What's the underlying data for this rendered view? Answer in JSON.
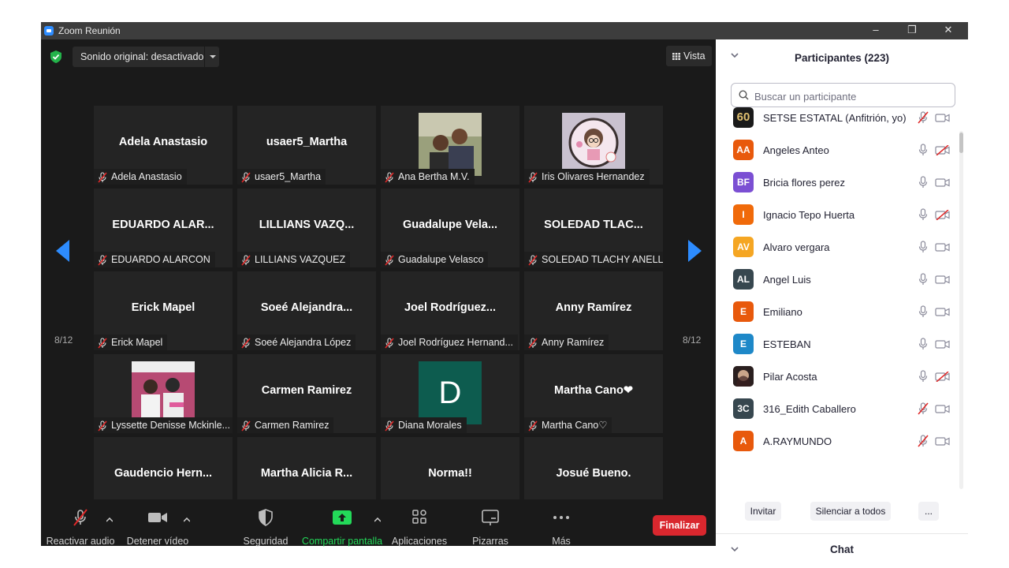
{
  "window": {
    "title": "Zoom Reunión",
    "minimize": "–",
    "restore": "❐",
    "close": "✕"
  },
  "meeting": {
    "audio_status": "Sonido original: desactivado",
    "view_label": "Vista",
    "page_left": "8/12",
    "page_right": "8/12",
    "tiles": [
      {
        "big": "Adela Anastasio",
        "name": "Adela Anastasio"
      },
      {
        "big": "usaer5_Martha",
        "name": "usaer5_Martha"
      },
      {
        "big": "",
        "name": "Ana Bertha M.V."
      },
      {
        "big": "",
        "name": "Iris Olivares Hernandez"
      },
      {
        "big": "EDUARDO ALAR...",
        "name": "EDUARDO ALARCON"
      },
      {
        "big": "LILLIANS VAZQ...",
        "name": "LILLIANS VAZQUEZ"
      },
      {
        "big": "Guadalupe  Vela...",
        "name": "Guadalupe Velasco"
      },
      {
        "big": "SOLEDAD  TLAC...",
        "name": "SOLEDAD TLACHY ANELL"
      },
      {
        "big": "Erick Mapel",
        "name": "Erick Mapel"
      },
      {
        "big": "Soeé  Alejandra...",
        "name": "Soeé Alejandra López"
      },
      {
        "big": "Joel  Rodríguez...",
        "name": "Joel Rodríguez Hernand..."
      },
      {
        "big": "Anny Ramírez",
        "name": "Anny Ramírez"
      },
      {
        "big": "",
        "name": "Lyssette Denisse Mckinle..."
      },
      {
        "big": "Carmen Ramirez",
        "name": "Carmen Ramirez"
      },
      {
        "big": "",
        "name": "Diana Morales",
        "initial": "D"
      },
      {
        "big": "Martha  Cano❤",
        "name": "Martha Cano♡"
      },
      {
        "big": "Gaudencio  Hern...",
        "name": "Gaudencio Hernández V..."
      },
      {
        "big": "Martha Alicia  R...",
        "name": "Martha Alicia Ramos Na..."
      },
      {
        "big": "Norma!!",
        "name": "Norma!!"
      },
      {
        "big": "Josué Bueno.",
        "name": "Josué Bueno."
      }
    ]
  },
  "toolbar": {
    "unmute": "Reactivar audio",
    "stop_video": "Detener vídeo",
    "security": "Seguridad",
    "share": "Compartir pantalla",
    "apps": "Aplicaciones",
    "whiteboards": "Pizarras",
    "more": "Más",
    "end": "Finalizar",
    "share_color": "#23d959",
    "end_color": "#d9272e"
  },
  "participants": {
    "title": "Participantes (223)",
    "search_placeholder": "Buscar un participante",
    "items": [
      {
        "name": "SETSE ESTATAL (Anfitrión, yo)",
        "initials": "60",
        "color": "#1a1a1a",
        "mic": "muted",
        "cam": "on"
      },
      {
        "name": "Angeles Anteo",
        "initials": "AA",
        "color": "#e8590c",
        "mic": "on",
        "cam": "off"
      },
      {
        "name": "Bricia flores perez",
        "initials": "BF",
        "color": "#7b4fd3",
        "mic": "on",
        "cam": "on"
      },
      {
        "name": "Ignacio Tepo Huerta",
        "initials": "I",
        "color": "#f06a0a",
        "mic": "on",
        "cam": "off"
      },
      {
        "name": "Alvaro vergara",
        "initials": "AV",
        "color": "#f5a623",
        "mic": "on",
        "cam": "on"
      },
      {
        "name": "Angel Luis",
        "initials": "AL",
        "color": "#37474f",
        "mic": "on",
        "cam": "on"
      },
      {
        "name": "Emiliano",
        "initials": "E",
        "color": "#e8590c",
        "mic": "on",
        "cam": "on"
      },
      {
        "name": "ESTEBAN",
        "initials": "E",
        "color": "#1e88c8",
        "mic": "on",
        "cam": "on"
      },
      {
        "name": "Pilar Acosta",
        "initials": "",
        "color": "#3a2a2a",
        "mic": "on",
        "cam": "off"
      },
      {
        "name": "316_Edith Caballero",
        "initials": "3C",
        "color": "#37474f",
        "mic": "muted",
        "cam": "on"
      },
      {
        "name": "A.RAYMUNDO",
        "initials": "A",
        "color": "#e8590c",
        "mic": "muted",
        "cam": "on"
      }
    ],
    "invite": "Invitar",
    "mute_all": "Silenciar a todos",
    "more": "..."
  },
  "chat": {
    "title": "Chat"
  }
}
